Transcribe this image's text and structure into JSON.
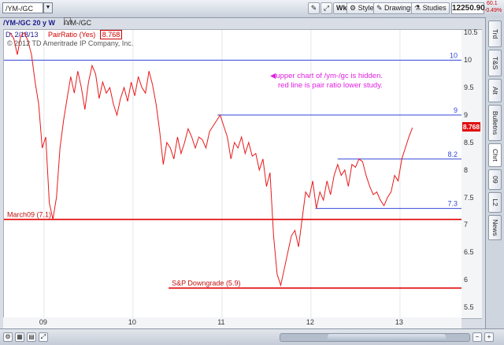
{
  "toolbar": {
    "symbol": "/YM-/GC",
    "wk_label": "Wk",
    "style_label": "Style",
    "drawings_label": "Drawings",
    "studies_label": "Studies",
    "last_price": "12250.90",
    "change_top": "60.1",
    "change_bottom": "-0.49%"
  },
  "chart_header": {
    "study_title": "/YM-/GC 20 y W",
    "symbol_label": "/YM-/GC",
    "date": "D: 2/18/13",
    "indicator": "PairRatio (Yes)",
    "indicator_value": "8.768"
  },
  "copyright": "© 2012 TD Ameritrade IP Company, Inc.",
  "right_tabs": [
    "Trd",
    "T&S",
    "Alt",
    "Bulletns",
    "Chrt",
    "09",
    "L2",
    "News"
  ],
  "annotations": {
    "note_line1": "upper chart of /ym-/gc is hidden.",
    "note_line2": "red line is pair ratio lower study.",
    "level_10": "10",
    "level_9": "9",
    "level_82": "8.2",
    "level_73": "7.3",
    "march09": "March09  (7.1)",
    "sp_downgrade": "S&P Downgrade (5.9)"
  },
  "current_value_badge": "8.768",
  "colors": {
    "series": "#e8191a",
    "hline_blue": "#3346d8",
    "hline_red": "#e00000",
    "note": "#e020e0"
  },
  "chart_data": {
    "type": "line",
    "y_ticks": [
      "10.5",
      "10",
      "9.5",
      "9",
      "8.5",
      "8",
      "7.5",
      "7",
      "6.5",
      "6",
      "5.5"
    ],
    "x_ticks": [
      "09",
      "10",
      "11",
      "12",
      "13"
    ],
    "ylim": [
      5.3,
      10.55
    ],
    "xlim": [
      2008.55,
      2013.7
    ],
    "series": [
      {
        "x": [
          2008.62,
          2008.66,
          2008.7,
          2008.74,
          2008.78,
          2008.82,
          2008.86,
          2008.9,
          2008.94,
          2008.98,
          2009.02,
          2009.06,
          2009.1,
          2009.14,
          2009.18,
          2009.22,
          2009.26,
          2009.3,
          2009.34,
          2009.38,
          2009.42,
          2009.46,
          2009.5,
          2009.54,
          2009.58,
          2009.62,
          2009.66,
          2009.7,
          2009.74,
          2009.78,
          2009.82,
          2009.86,
          2009.9,
          2009.94,
          2009.98,
          2010.02,
          2010.06,
          2010.1,
          2010.14,
          2010.18,
          2010.22,
          2010.26,
          2010.3,
          2010.34,
          2010.38,
          2010.42,
          2010.46,
          2010.5,
          2010.54,
          2010.58,
          2010.62,
          2010.66,
          2010.7,
          2010.74,
          2010.78,
          2010.82,
          2010.86,
          2010.9,
          2010.94,
          2010.98,
          2011.02,
          2011.06,
          2011.1,
          2011.14,
          2011.18,
          2011.22,
          2011.26,
          2011.3,
          2011.34,
          2011.38,
          2011.42,
          2011.46,
          2011.5,
          2011.54,
          2011.58,
          2011.62,
          2011.66,
          2011.7,
          2011.74,
          2011.78,
          2011.82,
          2011.86,
          2011.9,
          2011.94,
          2011.98,
          2012.02,
          2012.06,
          2012.1,
          2012.14,
          2012.18,
          2012.22,
          2012.26,
          2012.3,
          2012.34,
          2012.38,
          2012.42,
          2012.46,
          2012.5,
          2012.54,
          2012.58,
          2012.62,
          2012.66,
          2012.7,
          2012.74,
          2012.78,
          2012.82,
          2012.86,
          2012.9,
          2012.94,
          2012.98,
          2013.02,
          2013.06,
          2013.1,
          2013.14
        ],
        "y": [
          10.5,
          10.4,
          10.1,
          10.45,
          10.5,
          10.35,
          10.1,
          9.6,
          9.2,
          8.4,
          8.6,
          7.4,
          7.1,
          7.5,
          8.4,
          8.9,
          9.3,
          9.7,
          9.4,
          9.8,
          9.5,
          9.1,
          9.6,
          9.9,
          9.75,
          9.3,
          9.6,
          9.4,
          9.5,
          9.2,
          9.0,
          9.3,
          9.5,
          9.25,
          9.6,
          9.35,
          9.7,
          9.5,
          9.4,
          9.8,
          9.55,
          9.2,
          8.7,
          8.1,
          8.5,
          8.4,
          8.2,
          8.6,
          8.3,
          8.5,
          8.75,
          8.6,
          8.4,
          8.6,
          8.55,
          8.4,
          8.7,
          8.8,
          8.9,
          9.0,
          8.8,
          8.6,
          8.2,
          8.5,
          8.4,
          8.6,
          8.3,
          8.5,
          8.25,
          8.3,
          8.0,
          8.2,
          7.7,
          7.95,
          6.8,
          6.1,
          5.9,
          6.2,
          6.5,
          6.8,
          6.9,
          6.6,
          7.1,
          7.6,
          7.5,
          7.8,
          7.3,
          7.6,
          7.45,
          7.8,
          7.55,
          7.9,
          8.1,
          7.9,
          8.0,
          7.7,
          8.1,
          8.05,
          8.2,
          8.15,
          7.9,
          7.7,
          7.55,
          7.6,
          7.45,
          7.35,
          7.5,
          7.6,
          7.9,
          7.8,
          8.2,
          8.4,
          8.6,
          8.768
        ]
      }
    ],
    "hlines": [
      {
        "y": 10,
        "x_from": 2008.55,
        "x_to": 2013.7,
        "color": "blue",
        "label": "10"
      },
      {
        "y": 9,
        "x_from": 2010.95,
        "x_to": 2013.7,
        "color": "blue",
        "label": "9"
      },
      {
        "y": 8.2,
        "x_from": 2012.3,
        "x_to": 2013.7,
        "color": "blue",
        "label": "8.2"
      },
      {
        "y": 7.3,
        "x_from": 2012.05,
        "x_to": 2013.7,
        "color": "blue",
        "label": "7.3"
      },
      {
        "y": 7.1,
        "x_from": 2008.55,
        "x_to": 2013.7,
        "color": "red",
        "label": "March09  (7.1)"
      },
      {
        "y": 5.85,
        "x_from": 2010.4,
        "x_to": 2013.7,
        "color": "red",
        "label": "S&P Downgrade (5.9)"
      }
    ]
  }
}
